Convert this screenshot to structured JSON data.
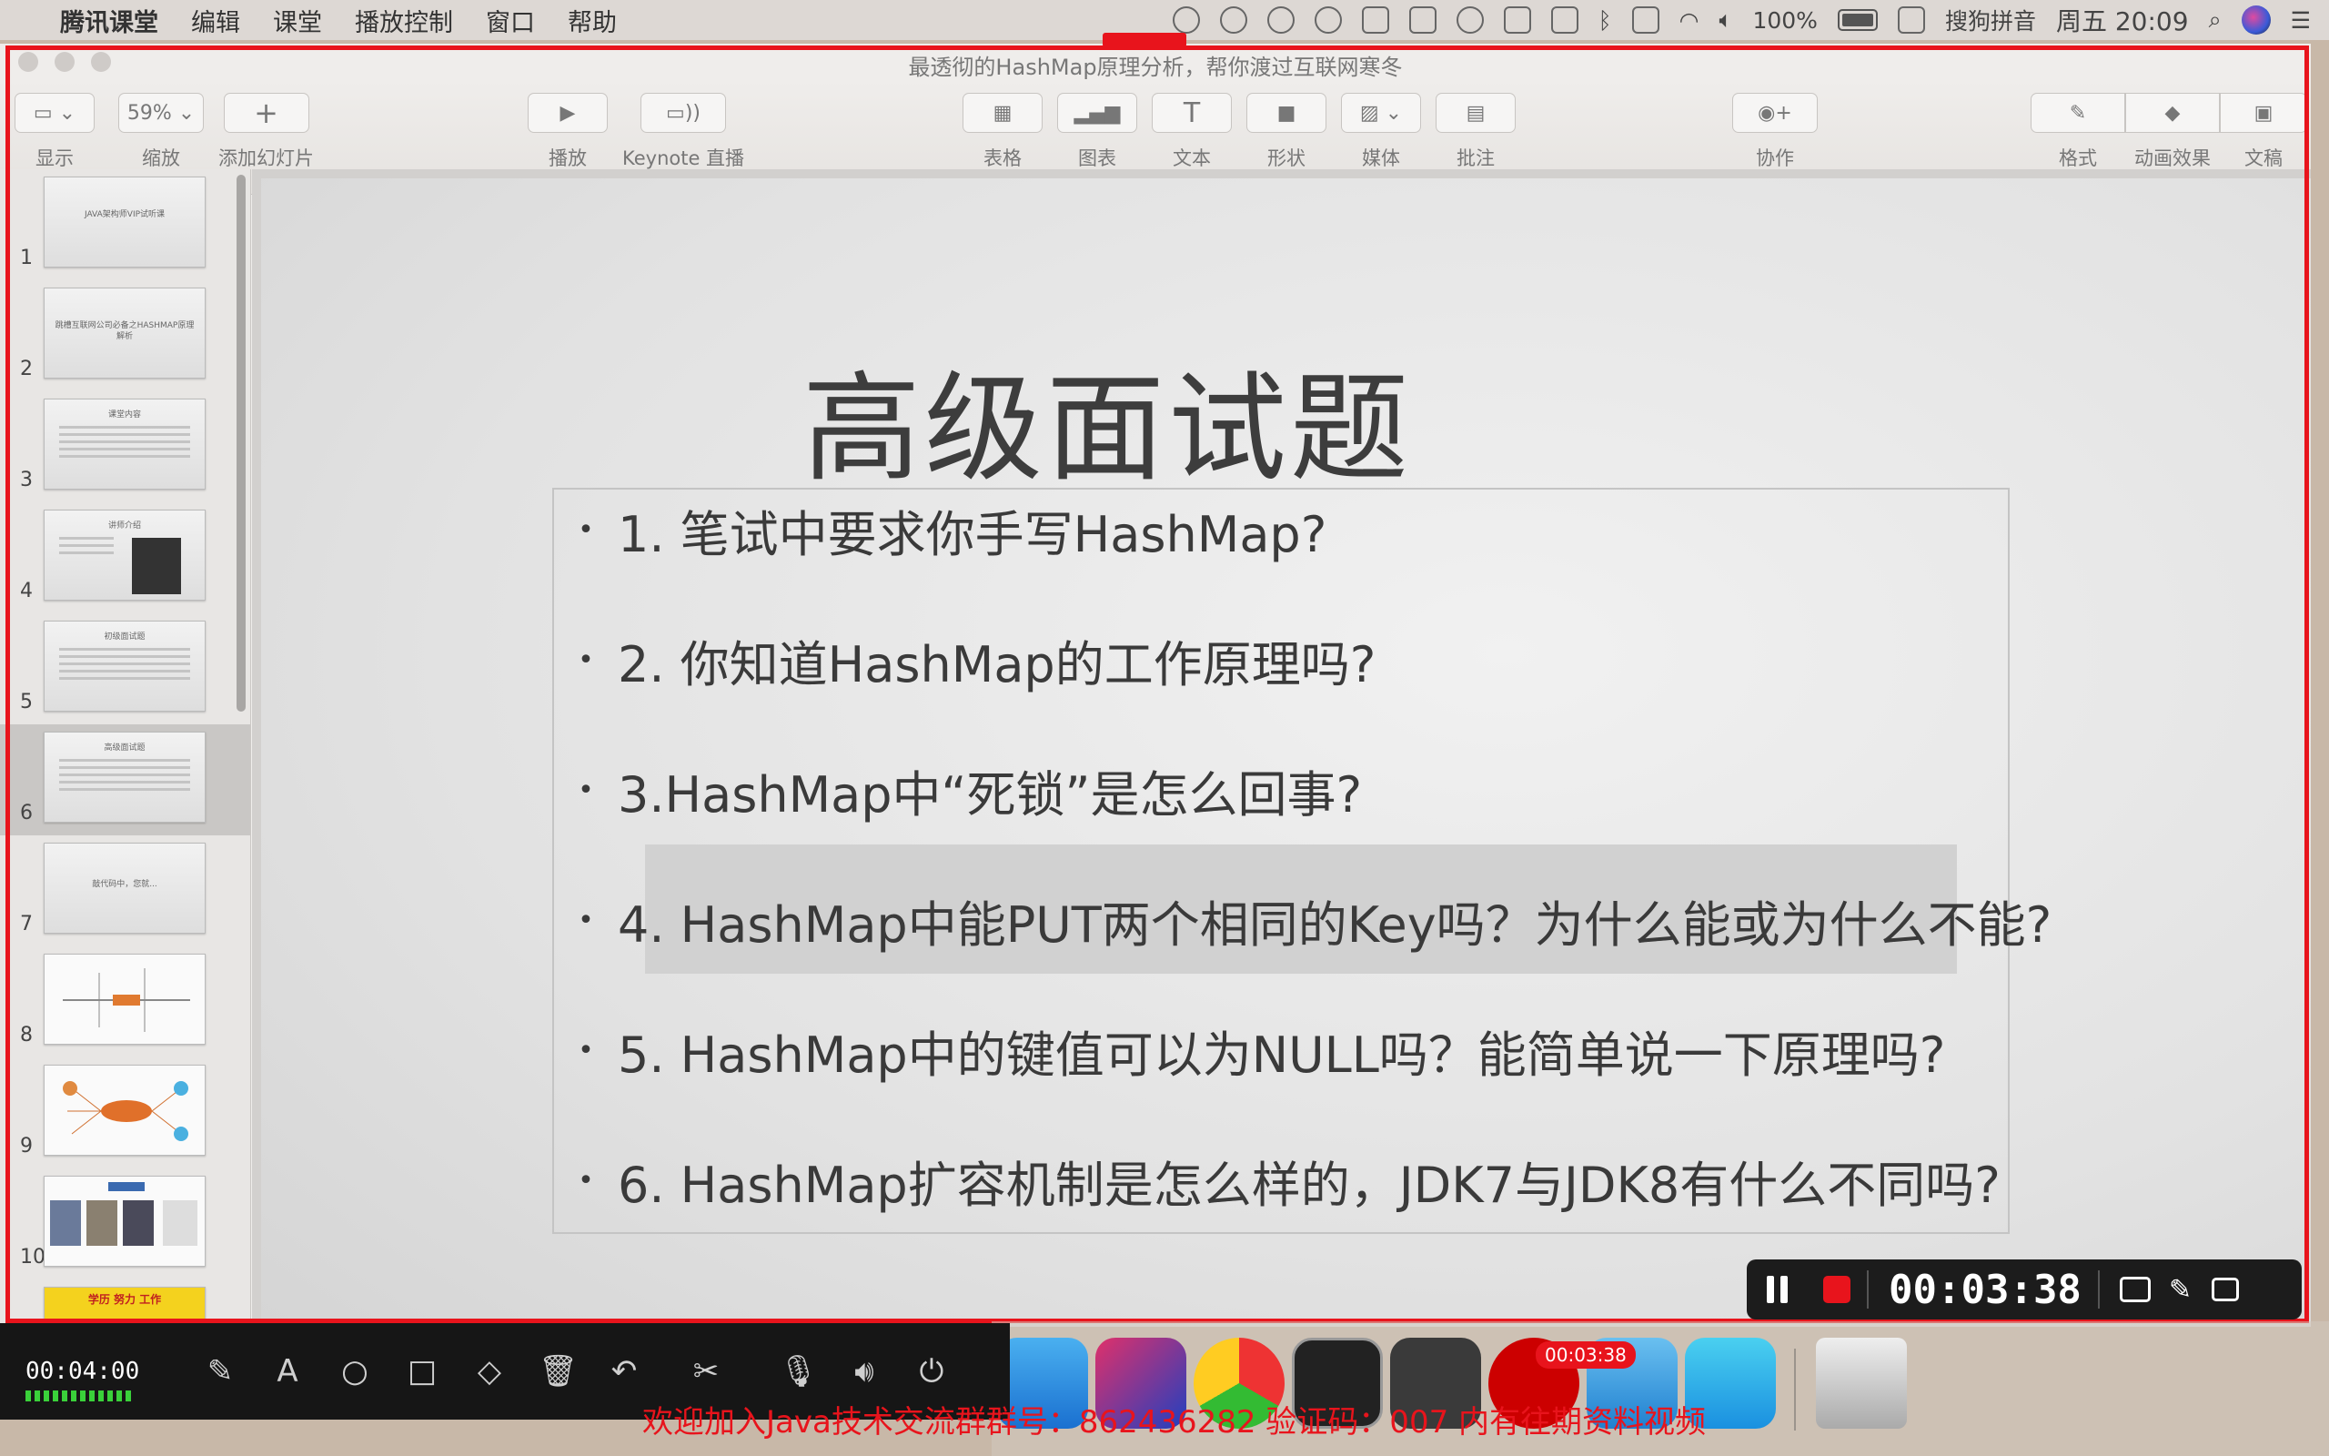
{
  "menubar": {
    "app_name": "腾讯课堂",
    "items": [
      "编辑",
      "课堂",
      "播放控制",
      "窗口",
      "帮助"
    ],
    "battery": "100%",
    "input_method": "搜狗拼音",
    "clock": "周五 20:09"
  },
  "window": {
    "doc_title": "最透彻的HashMap原理分析，帮你渡过互联网寒冬"
  },
  "toolbar": {
    "view_label": "显示",
    "zoom_value": "59%",
    "zoom_label": "缩放",
    "add_slide_label": "添加幻灯片",
    "play_label": "播放",
    "keynote_live_label": "Keynote 直播",
    "table_label": "表格",
    "chart_label": "图表",
    "text_label": "文本",
    "shape_label": "形状",
    "media_label": "媒体",
    "comment_label": "批注",
    "collaborate_label": "协作",
    "format_label": "格式",
    "animate_label": "动画效果",
    "document_label": "文稿"
  },
  "slides": [
    {
      "num": "1",
      "title": "JAVA架构师VIP试听课"
    },
    {
      "num": "2",
      "title": "跳槽互联网公司必备之HASHMAP原理解析"
    },
    {
      "num": "3",
      "title": "课堂内容"
    },
    {
      "num": "4",
      "title": "讲师介绍"
    },
    {
      "num": "5",
      "title": "初级面试题"
    },
    {
      "num": "6",
      "title": "高级面试题"
    },
    {
      "num": "7",
      "title": "敲代码中，您就..."
    },
    {
      "num": "8",
      "title": ""
    },
    {
      "num": "9",
      "title": ""
    },
    {
      "num": "10",
      "title": ""
    },
    {
      "num": "",
      "title": "学历 努力 工作"
    }
  ],
  "current_slide": {
    "title": "高级面试题",
    "questions": [
      "1. 笔试中要求你手写HashMap?",
      "2. 你知道HashMap的工作原理吗?",
      "3.HashMap中“死锁”是怎么回事?",
      "4. HashMap中能PUT两个相同的Key吗？为什么能或为什么不能?",
      "5. HashMap中的键值可以为NULL吗？能简单说一下原理吗?",
      "6. HashMap扩容机制是怎么样的，JDK7与JDK8有什么不同吗?"
    ]
  },
  "recorder": {
    "elapsed": "00:03:38",
    "bar_time": "00:04:00",
    "dock_badge": "00:03:38"
  },
  "watermark": "欢迎加入Java技术交流群群号：862436282  验证码：007  内有往期资料视频"
}
